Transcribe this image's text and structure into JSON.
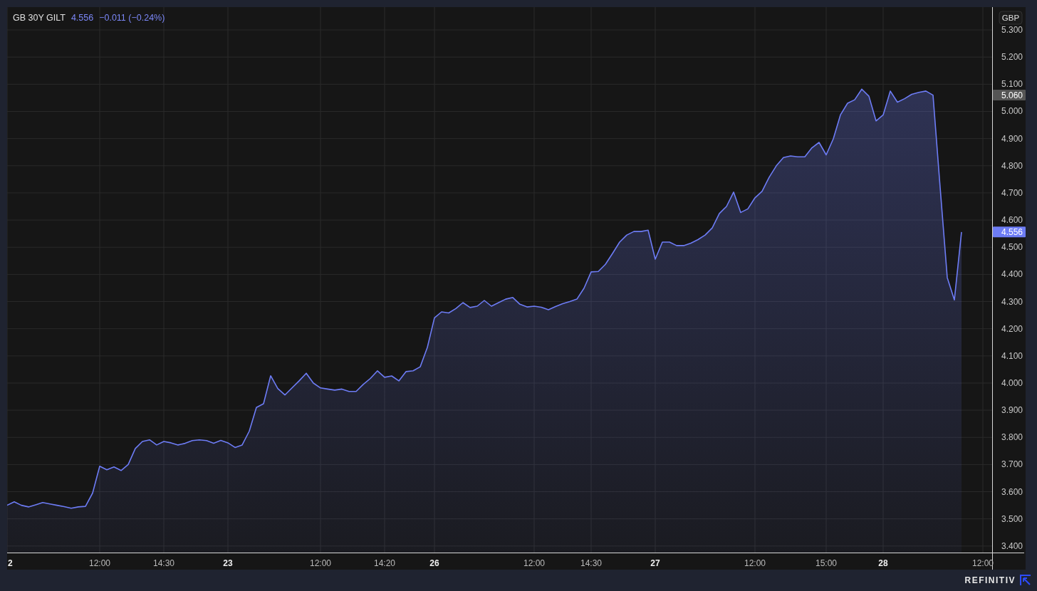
{
  "legend": {
    "last": "4.556",
    "change": "−0.011 (−0.24%)"
  },
  "currency": "GBP",
  "price_tags": [
    {
      "kind": "high",
      "label": "5.060"
    },
    {
      "kind": "last",
      "label": "4.556"
    }
  ],
  "chart_data": {
    "type": "area",
    "grid": true,
    "ylim": [
      3.376,
      5.384
    ],
    "yticks": [
      {
        "value": 3.4,
        "label": "3.400"
      },
      {
        "value": 3.5,
        "label": "3.500"
      },
      {
        "value": 3.6,
        "label": "3.600"
      },
      {
        "value": 3.7,
        "label": "3.700"
      },
      {
        "value": 3.8,
        "label": "3.800"
      },
      {
        "value": 3.9,
        "label": "3.900"
      },
      {
        "value": 4.0,
        "label": "4.000"
      },
      {
        "value": 4.1,
        "label": "4.100"
      },
      {
        "value": 4.2,
        "label": "4.200"
      },
      {
        "value": 4.3,
        "label": "4.300"
      },
      {
        "value": 4.4,
        "label": "4.400"
      },
      {
        "value": 4.5,
        "label": "4.500"
      },
      {
        "value": 4.6,
        "label": "4.600"
      },
      {
        "value": 4.7,
        "label": "4.700"
      },
      {
        "value": 4.8,
        "label": "4.800"
      },
      {
        "value": 4.9,
        "label": "4.900"
      },
      {
        "value": 5.0,
        "label": "5.000"
      },
      {
        "value": 5.1,
        "label": "5.100"
      },
      {
        "value": 5.2,
        "label": "5.200"
      },
      {
        "value": 5.3,
        "label": "5.300"
      }
    ],
    "categories": [
      "2",
      null,
      null,
      null,
      null,
      null,
      null,
      null,
      null,
      null,
      null,
      null,
      null,
      "12:00",
      null,
      null,
      null,
      null,
      null,
      null,
      null,
      null,
      "14:30",
      null,
      null,
      null,
      null,
      null,
      null,
      null,
      null,
      "23",
      null,
      null,
      null,
      null,
      null,
      null,
      null,
      null,
      null,
      null,
      null,
      null,
      "12:00",
      null,
      null,
      null,
      null,
      null,
      null,
      null,
      null,
      "14:20",
      null,
      null,
      null,
      null,
      null,
      null,
      "26",
      null,
      null,
      null,
      null,
      null,
      null,
      null,
      null,
      null,
      null,
      null,
      null,
      null,
      "12:00",
      null,
      null,
      null,
      null,
      null,
      null,
      null,
      "14:30",
      null,
      null,
      null,
      null,
      null,
      null,
      null,
      null,
      "27",
      null,
      null,
      null,
      null,
      null,
      null,
      null,
      null,
      null,
      null,
      null,
      null,
      null,
      "12:00",
      null,
      null,
      null,
      null,
      null,
      null,
      null,
      null,
      null,
      "15:00",
      null,
      null,
      null,
      null,
      null,
      null,
      null,
      "28",
      null,
      null,
      null,
      null,
      null,
      null,
      null,
      null,
      null,
      null,
      null,
      null,
      null,
      "12:00"
    ],
    "series": [
      {
        "name": "GB 30Y GILT",
        "color": "#6d7cf5",
        "values": [
          3.55,
          3.563,
          3.55,
          3.544,
          3.552,
          3.56,
          3.555,
          3.55,
          3.545,
          3.539,
          3.544,
          3.546,
          3.595,
          3.694,
          3.681,
          3.691,
          3.678,
          3.7,
          3.759,
          3.785,
          3.791,
          3.772,
          3.785,
          3.78,
          3.772,
          3.778,
          3.788,
          3.791,
          3.788,
          3.778,
          3.789,
          3.78,
          3.763,
          3.772,
          3.823,
          3.91,
          3.924,
          4.027,
          3.98,
          3.956,
          3.982,
          4.008,
          4.036,
          4.0,
          3.982,
          3.978,
          3.974,
          3.978,
          3.969,
          3.969,
          3.995,
          4.017,
          4.045,
          4.021,
          4.026,
          4.008,
          4.042,
          4.045,
          4.06,
          4.131,
          4.24,
          4.262,
          4.258,
          4.274,
          4.296,
          4.278,
          4.283,
          4.304,
          4.283,
          4.296,
          4.309,
          4.315,
          4.29,
          4.28,
          4.283,
          4.279,
          4.27,
          4.282,
          4.292,
          4.3,
          4.309,
          4.349,
          4.409,
          4.411,
          4.437,
          4.477,
          4.519,
          4.545,
          4.558,
          4.558,
          4.563,
          4.456,
          4.519,
          4.519,
          4.506,
          4.506,
          4.515,
          4.528,
          4.545,
          4.571,
          4.624,
          4.65,
          4.703,
          4.628,
          4.641,
          4.682,
          4.706,
          4.758,
          4.8,
          4.83,
          4.836,
          4.833,
          4.833,
          4.866,
          4.886,
          4.84,
          4.899,
          4.987,
          5.03,
          5.043,
          5.082,
          5.056,
          4.965,
          4.987,
          5.075,
          5.034,
          5.047,
          5.063,
          5.07,
          5.075,
          5.06,
          4.72,
          4.388,
          4.306,
          4.556,
          null,
          null,
          null
        ]
      }
    ]
  },
  "footer": {
    "brand": "REFINITIV"
  }
}
